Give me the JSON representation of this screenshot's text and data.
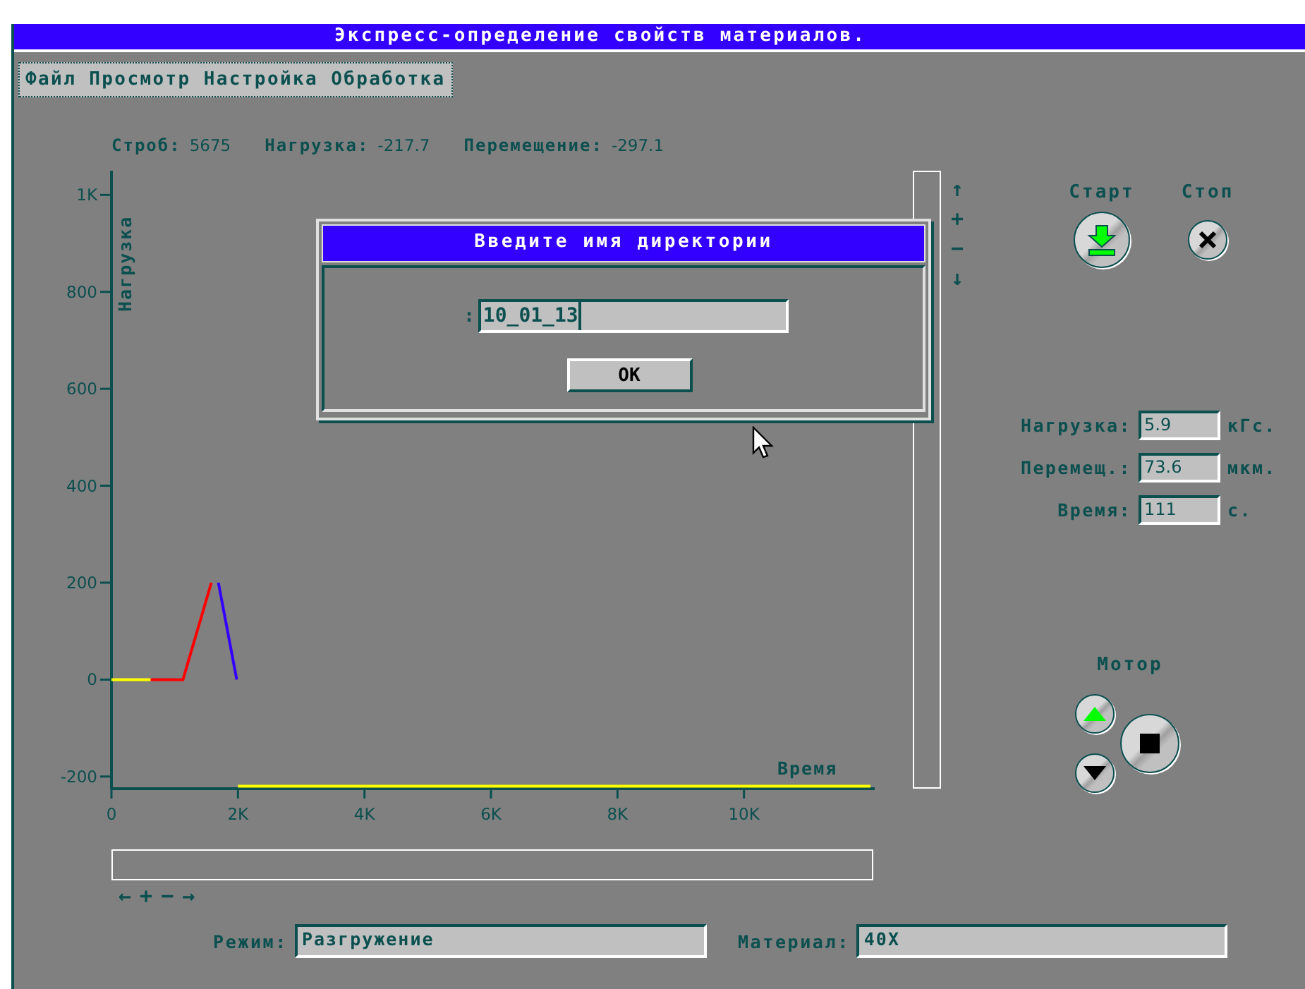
{
  "window": {
    "title": "Экспресс-определение свойств материалов."
  },
  "menu": [
    "Файл",
    "Просмотр",
    "Настройка",
    "Обработка"
  ],
  "status": [
    {
      "label": "Строб:",
      "value": "5675"
    },
    {
      "label": "Нагрузка:",
      "value": "-217.7"
    },
    {
      "label": "Перемещение:",
      "value": "-297.1"
    }
  ],
  "chart": {
    "chart_data": {
      "type": "line",
      "xlabel": "Время",
      "ylabel": "Нагрузка",
      "x": [
        0,
        620,
        1130,
        1580,
        1690,
        1980,
        2000,
        12000
      ],
      "series": [
        {
          "color": "#ffff00",
          "values": [
            0,
            0,
            null,
            null,
            null,
            null,
            null,
            null
          ]
        },
        {
          "color": "#ff0000",
          "values": [
            null,
            0,
            0,
            200,
            null,
            null,
            null,
            null
          ]
        },
        {
          "color": "#3300ff",
          "values": [
            null,
            null,
            null,
            null,
            200,
            0,
            null,
            null
          ]
        },
        {
          "color": "#ffff00",
          "values": [
            null,
            null,
            null,
            null,
            null,
            null,
            -220,
            -220
          ]
        }
      ],
      "xlim": [
        0,
        12000
      ],
      "ylim": [
        -225,
        1050
      ],
      "xticks": [
        0,
        {
          "value": 2000,
          "label": "2K"
        },
        {
          "value": 4000,
          "label": "4K"
        },
        {
          "value": 6000,
          "label": "6K"
        },
        {
          "value": 8000,
          "label": "8K"
        },
        {
          "value": 10000,
          "label": "10K"
        }
      ],
      "yticks": [
        {
          "value": 1000,
          "label": "1K"
        },
        800,
        600,
        400,
        200,
        0,
        -200
      ]
    }
  },
  "vertical_scroll_buttons": [
    "↑",
    "+",
    "−",
    "↓"
  ],
  "horizontal_scroll_buttons": [
    "←",
    "+",
    "−",
    "→"
  ],
  "controls": {
    "start": {
      "label": "Старт"
    },
    "stop": {
      "label": "Стоп"
    }
  },
  "readings": [
    {
      "label": "Нагрузка:",
      "value": "5.9",
      "unit": "кГс."
    },
    {
      "label": "Перемещ.:",
      "value": "73.6",
      "unit": "мкм."
    },
    {
      "label": "Время:",
      "value": "111",
      "unit": "с."
    }
  ],
  "motor": {
    "label": "Мотор"
  },
  "bottom_fields": [
    {
      "label": "Режим:",
      "value": "Разгружение"
    },
    {
      "label": "Материал:",
      "value": "40Х"
    }
  ],
  "dialog": {
    "title": "Введите имя директории",
    "prompt": ":",
    "value": "10_01_13",
    "button": "OK"
  }
}
